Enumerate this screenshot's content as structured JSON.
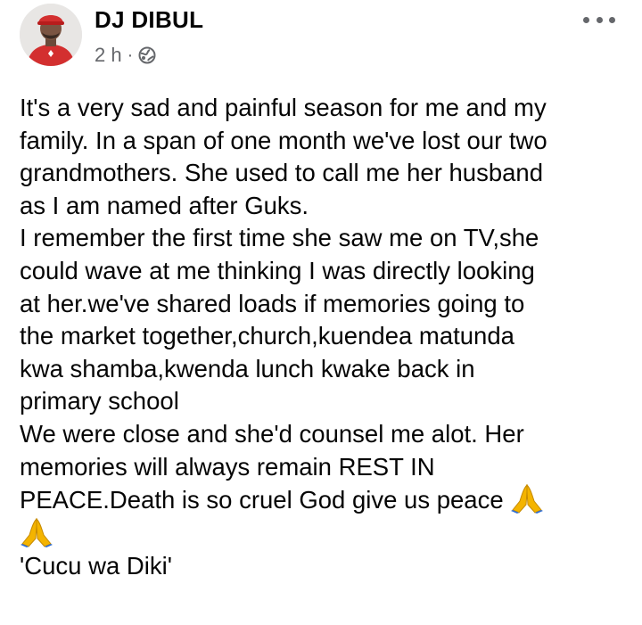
{
  "post": {
    "author": "DJ DIBUL",
    "time": "2 h",
    "separator": "·",
    "privacy_icon": "globe-icon",
    "more_icon": "more-horizontal-icon",
    "lines": [
      "It's a very sad and painful season for me and my",
      "family. In a span of one month we've lost our two",
      "grandmothers. She used to call me her husband",
      "as I am named after Guks.",
      "I remember the first time she saw me on TV,she",
      "could wave at me thinking I was directly looking",
      "at her.we've shared loads if memories going to",
      "the market together,church,kuendea matunda",
      "kwa shamba,kwenda lunch kwake back in",
      "primary school",
      "We were close and she'd counsel me alot. Her",
      "memories will always remain REST IN",
      "PEACE.Death is so cruel God give us peace"
    ],
    "emoji": "folded-hands-emoji",
    "signature": "'Cucu wa Diki'"
  },
  "colors": {
    "text": "#050505",
    "meta": "#65676b",
    "avatar_shirt": "#d32f2f",
    "emoji": "#f4b400"
  }
}
